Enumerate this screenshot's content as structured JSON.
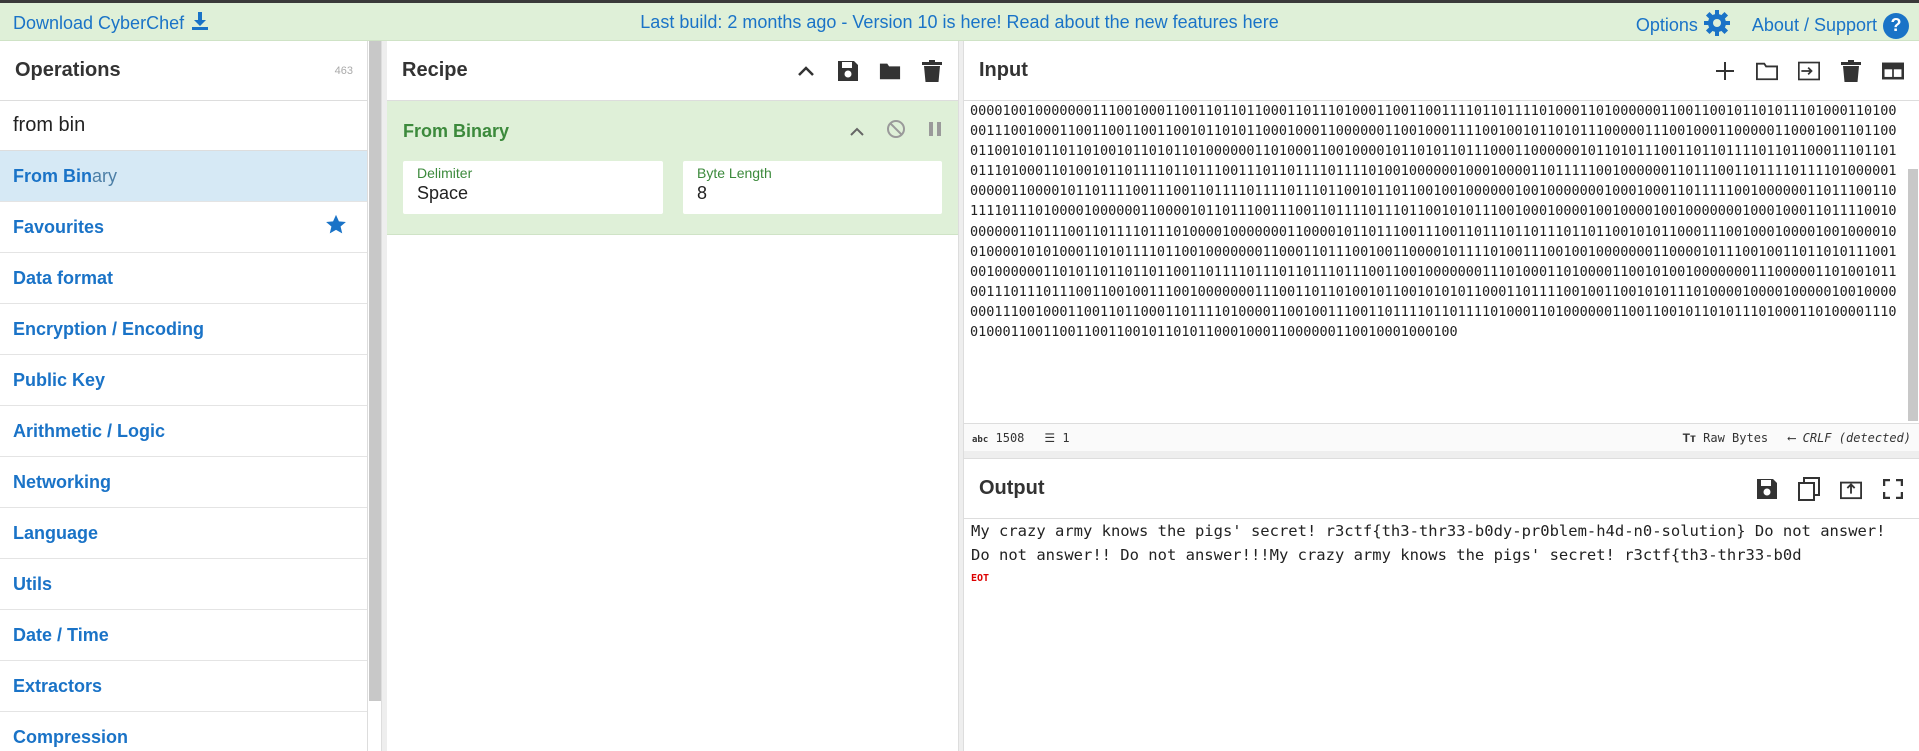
{
  "topbar": {
    "download_label": "Download CyberChef",
    "build_message": "Last build: 2 months ago - Version 10 is here! Read about the new features here",
    "options_label": "Options",
    "about_label": "About / Support",
    "about_icon_glyph": "?",
    "accent_color": "#1a73c7"
  },
  "operations": {
    "title": "Operations",
    "count": "463",
    "search_value": "from bin",
    "selected": {
      "match": "From Bin",
      "rest": "ary"
    },
    "categories": [
      "Favourites",
      "Data format",
      "Encryption / Encoding",
      "Public Key",
      "Arithmetic / Logic",
      "Networking",
      "Language",
      "Utils",
      "Date / Time",
      "Extractors",
      "Compression"
    ]
  },
  "recipe": {
    "title": "Recipe",
    "operation": {
      "name": "From Binary",
      "delimiter_label": "Delimiter",
      "delimiter_value": "Space",
      "byte_length_label": "Byte Length",
      "byte_length_value": "8"
    }
  },
  "input": {
    "title": "Input",
    "text": "000010010000000111001000110011011011000110111010001100110011110110111101000110100000011001100101101011101000110100001110010001100110011001100101101011000100011000000110010001111001001011010111000001110010001100000110001001101100011001010110110100101101011010000001101000110010000101101011011100011000000101101011100110110111101101100011101101011101000110100101101111011011100111011011110111101001000000100010000110111110010000001101110011011110111101000001000001100001011011110011100110111101111011101100101101100100100000010010000000100010001101111100100000011011100110111101110100001000000110000101101110011100110111101110110010101110010001000010010000100100000001000100011011110010000000110111001101111011101000010000000110000101101110011100110111011011101101100101011000111001000100001001000010010000101010001101011110110010000000110001101110010011000010111101001110010010000000110000101110010011011010111001001000000110101101101101100110111101110110111011100110010000000111010001101000011001010010000000111000001101001011001110111011100110010011100100000001110011011010010110010101011000110111100100110010101110100001000010000010010000000111001000110011011000110111101000011001001110011011110110111101000110100000011001100101101011101000110100001110010001100110011001100101101011000100011000000110010001000100",
    "stats": {
      "chars": "1508",
      "lines": "1"
    },
    "encoding": "Raw Bytes",
    "eol": "CRLF (detected)"
  },
  "output": {
    "title": "Output",
    "text": "My crazy army knows the pigs' secret! r3ctf{th3-thr33-b0dy-pr0blem-h4d-n0-solution} Do not answer! Do not answer!! Do not answer!!!My crazy army knows the pigs' secret! r3ctf{th3-thr33-b0d",
    "eot_label": "EOT"
  }
}
